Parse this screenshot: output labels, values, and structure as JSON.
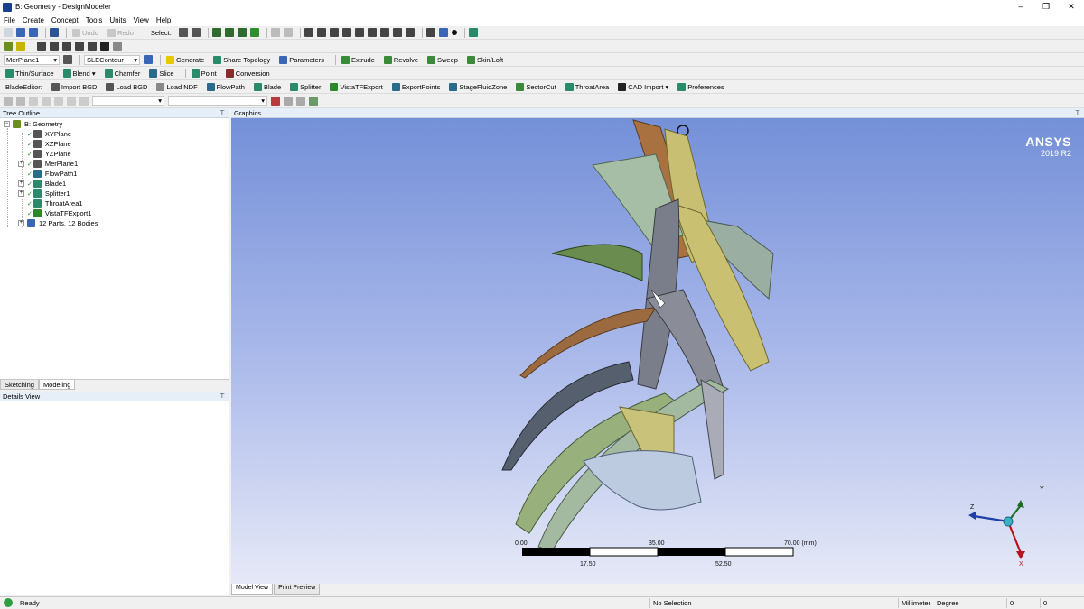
{
  "window": {
    "title": "B: Geometry - DesignModeler",
    "minimize": "–",
    "restore": "❐",
    "close": "✕"
  },
  "menu": [
    "File",
    "Create",
    "Concept",
    "Tools",
    "Units",
    "View",
    "Help"
  ],
  "toolbar1": {
    "undo": "Undo",
    "redo": "Redo",
    "select_label": "Select:"
  },
  "toolbar3": {
    "plane_combo": "MerPlane1",
    "sketch_combo": "SLEContour",
    "generate": "Generate",
    "share_topology": "Share Topology",
    "parameters": "Parameters",
    "extrude": "Extrude",
    "revolve": "Revolve",
    "sweep": "Sweep",
    "skin_loft": "Skin/Loft"
  },
  "toolbar4": {
    "thin_surface": "Thin/Surface",
    "blend": "Blend",
    "chamfer": "Chamfer",
    "slice": "Slice",
    "point": "Point",
    "conversion": "Conversion"
  },
  "toolbar5": {
    "blade_editor": "BladeEditor:",
    "import_bgd": "Import BGD",
    "load_bgd": "Load BGD",
    "load_ndf": "Load NDF",
    "flowpath": "FlowPath",
    "blade": "Blade",
    "splitter": "Splitter",
    "vista_tf_export": "VistaTFExport",
    "export_points": "ExportPoints",
    "stage_fluid_zone": "StageFluidZone",
    "sector_cut": "SectorCut",
    "throat_area": "ThroatArea",
    "cad_import": "CAD Import",
    "preferences": "Preferences"
  },
  "tree": {
    "header": "Tree Outline",
    "root": "B: Geometry",
    "items": [
      "XYPlane",
      "XZPlane",
      "YZPlane",
      "MerPlane1",
      "FlowPath1",
      "Blade1",
      "Splitter1",
      "ThroatArea1",
      "VistaTFExport1",
      "12 Parts, 12 Bodies"
    ]
  },
  "mode_tabs": [
    "Sketching",
    "Modeling"
  ],
  "details": {
    "header": "Details View"
  },
  "graphics": {
    "header": "Graphics",
    "logo_brand": "ANSYS",
    "logo_version": "2019 R2",
    "scale_top": [
      "0.00",
      "35.00",
      "70.00 (mm)"
    ],
    "scale_bottom": [
      "17.50",
      "52.50"
    ],
    "axes": {
      "x": "X",
      "y": "Y",
      "z": "Z"
    }
  },
  "bottom_tabs": [
    "Model View",
    "Print Preview"
  ],
  "status": {
    "ready": "Ready",
    "selection": "No Selection",
    "units": "Millimeter",
    "angle": "Degree",
    "v1": "0",
    "v2": "0"
  },
  "colors": {
    "accent": "#1b3f8f",
    "viewport_top": "#7490d8",
    "viewport_bottom": "#e6e9f7"
  }
}
